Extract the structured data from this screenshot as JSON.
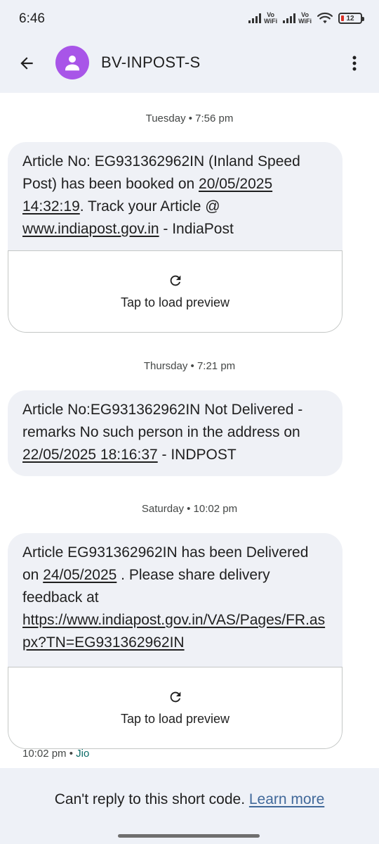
{
  "status_bar": {
    "time": "6:46",
    "vowifi_top": "Vo",
    "vowifi_bottom": "WiFi",
    "battery_level": "12",
    "battery_color": "#d93025"
  },
  "header": {
    "contact_name": "BV-INPOST-S",
    "avatar_color": "#a855e8",
    "icons": [
      "arrow-back-icon",
      "person-icon",
      "more-vert-icon"
    ]
  },
  "conversation": {
    "messages": [
      {
        "day": "Tuesday • 7:56 pm",
        "text_1": "Article No: EG931362962IN (Inland Speed Post) has been booked on ",
        "link_1": "20/05/2025 14:32:19",
        "text_2": ". Track your Article @ ",
        "link_2": "www.indiapost.gov.in",
        "text_3": " - IndiaPost",
        "preview_label": "Tap to load preview"
      },
      {
        "day": "Thursday • 7:21 pm",
        "text_1": "Article No:EG931362962IN Not Delivered - remarks No such person in the address on ",
        "link_1": "22/05/2025 18:16:37",
        "text_2": " - INDPOST"
      },
      {
        "day": "Saturday • 10:02 pm",
        "text_1": "Article EG931362962IN has been Delivered on ",
        "link_1": "24/05/2025",
        "text_2": " . Please share delivery feedback at ",
        "link_2": "https://www.indiapost.gov.in/VAS/Pages/FR.aspx?TN=EG931362962IN",
        "preview_label": "Tap to load preview",
        "time": "10:02 pm",
        "separator": "•",
        "carrier": "Jio"
      }
    ]
  },
  "footer": {
    "message": "Can't reply to this short code.",
    "link": "Learn more",
    "link_color": "#41699a"
  }
}
